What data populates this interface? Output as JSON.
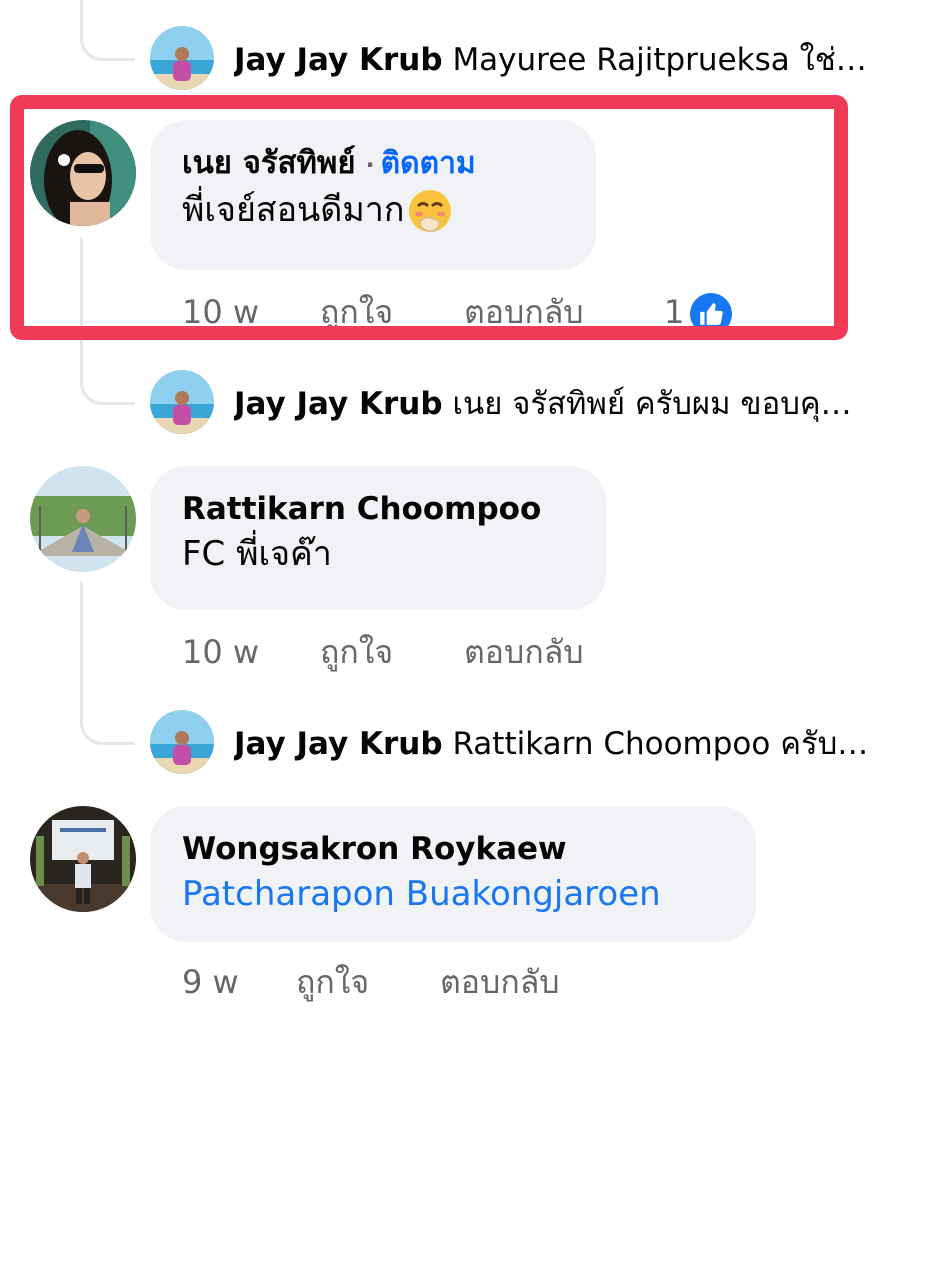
{
  "comments": [
    {
      "reply_preview": {
        "name": "Jay Jay Krub",
        "text": "Mayuree Rajitprueksa ใช่…"
      }
    },
    {
      "author": "เนย จรัสทิพย์",
      "follow_label": "ติดตาม",
      "text": "พี่เจย์สอนดีมาก",
      "emoji_icon": "face-with-hand-over-mouth-icon",
      "time": "10 w",
      "like_label": "ถูกใจ",
      "reply_label": "ตอบกลับ",
      "reaction_count": "1",
      "highlighted": true,
      "reply_preview": {
        "name": "Jay Jay Krub",
        "text": "เนย จรัสทิพย์ ครับผม ขอบคุ…"
      }
    },
    {
      "author": "Rattikarn Choompoo",
      "text": "FC พี่เจค๊า",
      "time": "10 w",
      "like_label": "ถูกใจ",
      "reply_label": "ตอบกลับ",
      "reply_preview": {
        "name": "Jay Jay Krub",
        "text": "Rattikarn Choompoo ครับ…"
      }
    },
    {
      "author": "Wongsakron Roykaew",
      "text": "Patcharapon Buakongjaroen",
      "time": "9 w",
      "like_label": "ถูกใจ",
      "reply_label": "ตอบกลับ"
    }
  ],
  "colors": {
    "highlight_border": "#f13a55",
    "link_blue": "#1877f2",
    "bubble_bg": "#f0f2f5",
    "meta_gray": "#65676b"
  }
}
